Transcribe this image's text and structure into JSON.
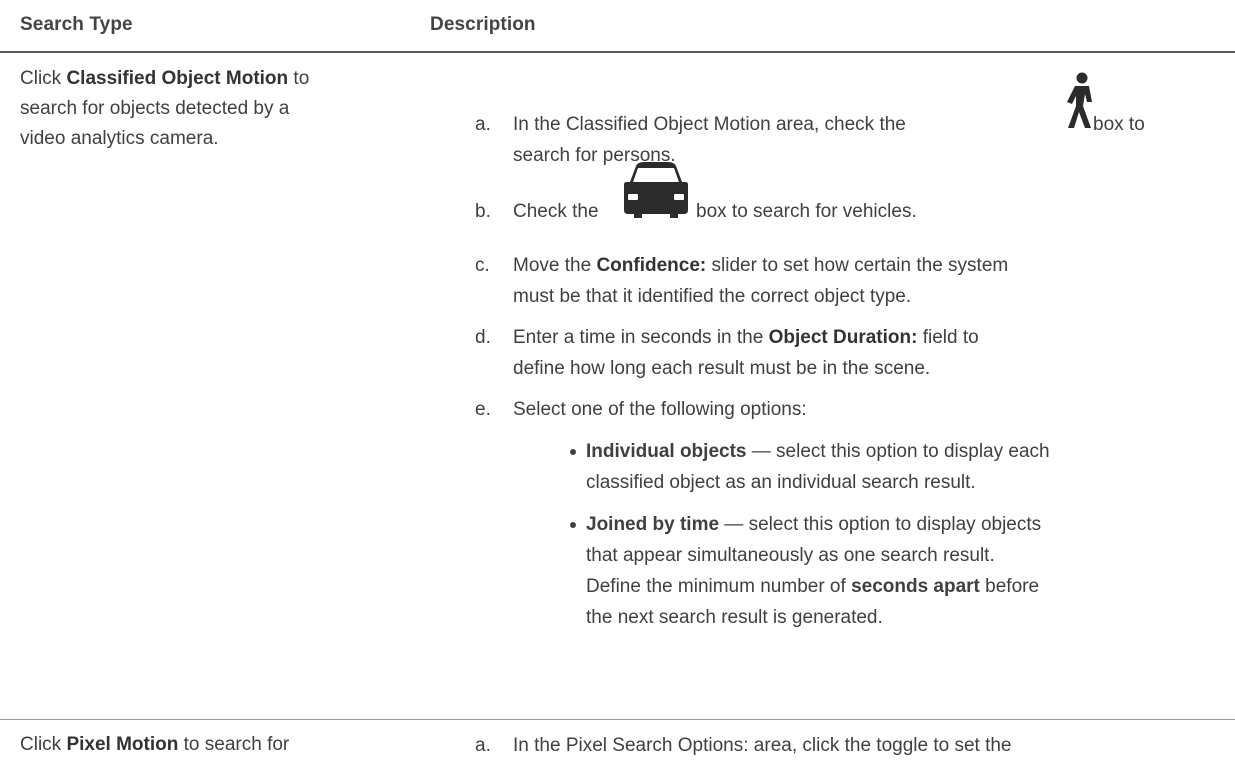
{
  "table": {
    "headers": {
      "search_type": "Search Type",
      "description": "Description"
    },
    "rows": [
      {
        "type": {
          "prefix": "Click ",
          "bold": "Classified Object Motion",
          "suffix_line1": " to",
          "line2": "search for objects detected by a",
          "line3": "video analytics camera."
        },
        "steps": [
          {
            "marker": "a.",
            "line1_before_icon": "In the Classified Object Motion area, check the",
            "icon": "person-walking-icon",
            "line1_after_icon": "box to",
            "line2": "search for persons."
          },
          {
            "marker": "b.",
            "before_icon": "Check the",
            "icon": "car-icon",
            "after_icon": "box to search for vehicles."
          },
          {
            "marker": "c.",
            "prefix": "Move the ",
            "bold": "Confidence:",
            "suffix": " slider to set how certain the system",
            "line2": "must be that it identified the correct object type."
          },
          {
            "marker": "d.",
            "prefix": "Enter a time in seconds in the ",
            "bold": "Object Duration:",
            "suffix": " field to",
            "line2": "define how long each result must be in the scene."
          },
          {
            "marker": "e.",
            "text": "Select one of the following options:"
          }
        ],
        "options": [
          {
            "bold": "Individual objects",
            "line1": " — select this option to display each",
            "line2": "classified object as an individual search result."
          },
          {
            "bold": "Joined by time",
            "line1": " — select this option to display objects",
            "line2": "that appear simultaneously as one search result.",
            "line3_prefix": "Define the minimum number of ",
            "line3_bold": "seconds apart",
            "line3_suffix": " before",
            "line4": "the next search result is generated."
          }
        ]
      },
      {
        "type": {
          "prefix": "Click ",
          "bold": "Pixel Motion",
          "suffix": " to search for"
        },
        "steps": [
          {
            "marker": "a.",
            "text": "In the Pixel Search Options: area, click the toggle to set the"
          }
        ]
      }
    ]
  },
  "icons": {
    "person": "person-walking-icon",
    "vehicle": "car-icon"
  },
  "colors": {
    "text": "#404040",
    "header_rule": "#5a5a5a",
    "row_rule": "#9a9a9a"
  }
}
